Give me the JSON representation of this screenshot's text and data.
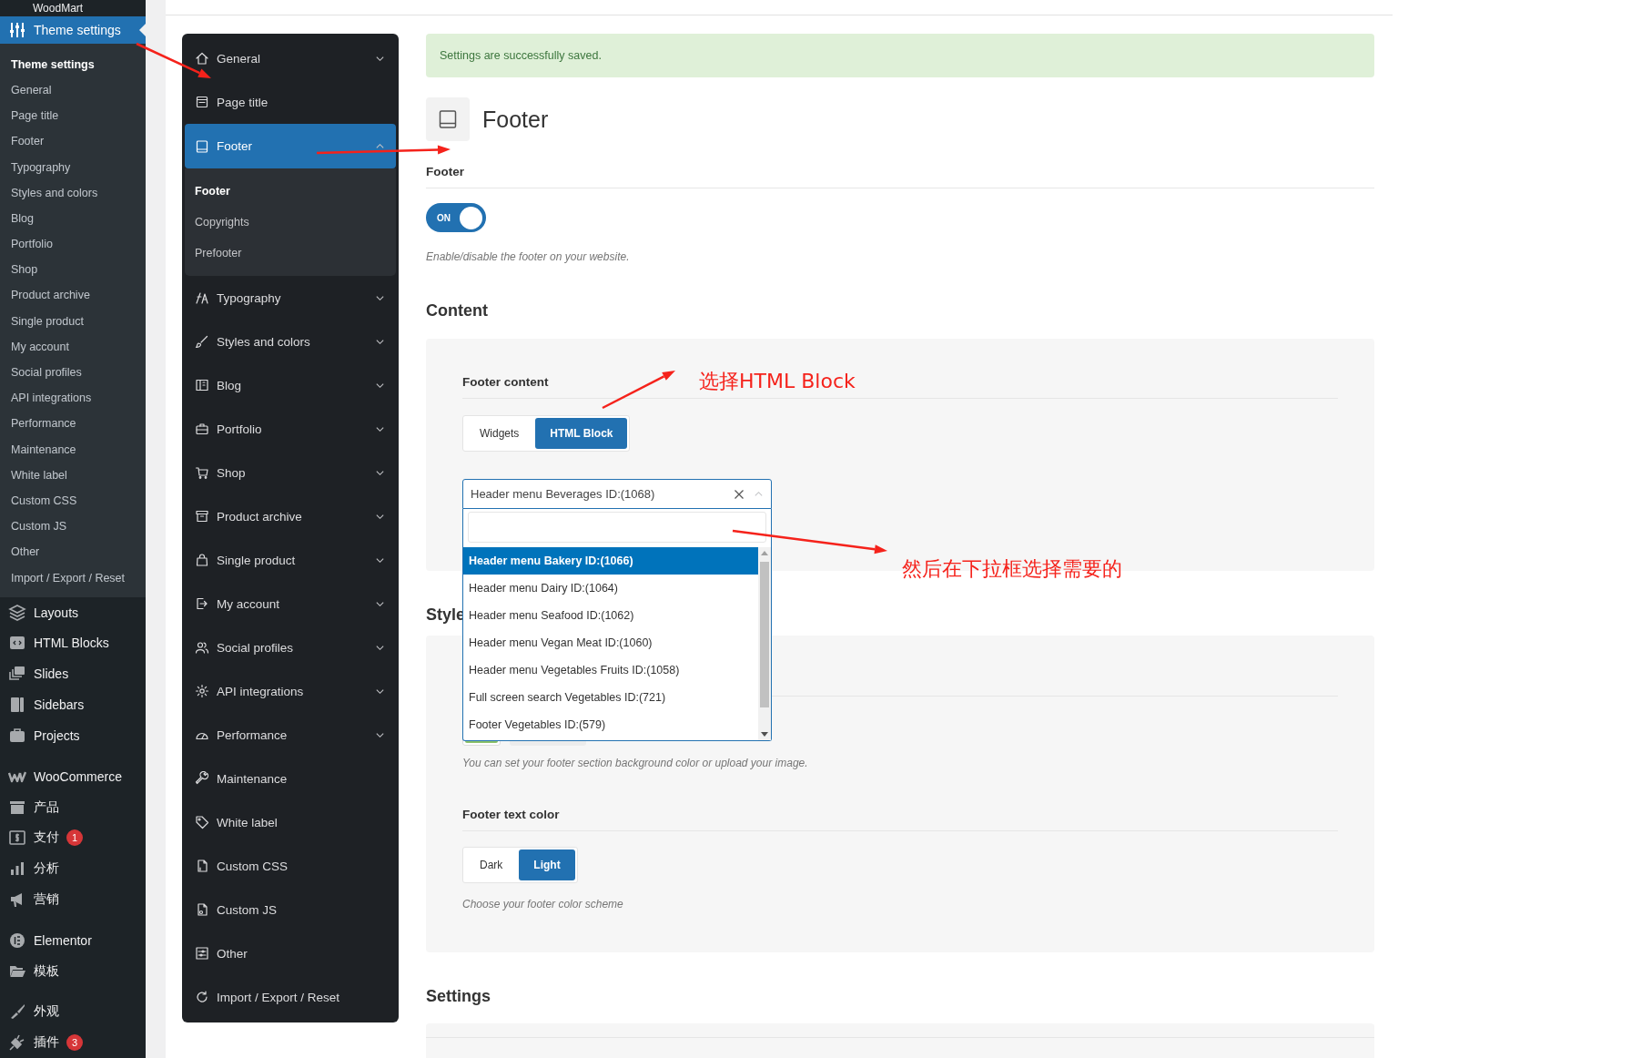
{
  "admin_menu": {
    "cut_item": "WoodMart",
    "groups": [
      [
        {
          "label": "Theme settings",
          "selected": true,
          "children": [
            {
              "label": "Theme settings",
              "selected": true
            },
            {
              "label": "General",
              "selected": false
            },
            {
              "label": "Page title",
              "selected": false
            },
            {
              "label": "Footer",
              "selected": false
            },
            {
              "label": "Typography",
              "selected": false
            },
            {
              "label": "Styles and colors",
              "selected": false
            },
            {
              "label": "Blog",
              "selected": false
            },
            {
              "label": "Portfolio",
              "selected": false
            },
            {
              "label": "Shop",
              "selected": false
            },
            {
              "label": "Product archive",
              "selected": false
            },
            {
              "label": "Single product",
              "selected": false
            },
            {
              "label": "My account",
              "selected": false
            },
            {
              "label": "Social profiles",
              "selected": false
            },
            {
              "label": "API integrations",
              "selected": false
            },
            {
              "label": "Performance",
              "selected": false
            },
            {
              "label": "Maintenance",
              "selected": false
            },
            {
              "label": "White label",
              "selected": false
            },
            {
              "label": "Custom CSS",
              "selected": false
            },
            {
              "label": "Custom JS",
              "selected": false
            },
            {
              "label": "Other",
              "selected": false
            },
            {
              "label": "Import / Export / Reset",
              "selected": false
            }
          ]
        },
        {
          "label": "Layouts",
          "selected": false
        },
        {
          "label": "HTML Blocks",
          "selected": false
        },
        {
          "label": "Slides",
          "selected": false
        },
        {
          "label": "Sidebars",
          "selected": false
        },
        {
          "label": "Projects",
          "selected": false
        }
      ],
      [
        {
          "label": "WooCommerce",
          "selected": false
        },
        {
          "label": "产品",
          "selected": false
        },
        {
          "label": "支付",
          "selected": false,
          "badge": "1"
        },
        {
          "label": "分析",
          "selected": false
        },
        {
          "label": "营销",
          "selected": false
        }
      ],
      [
        {
          "label": "Elementor",
          "selected": false
        },
        {
          "label": "模板",
          "selected": false
        }
      ],
      [
        {
          "label": "外观",
          "selected": false
        },
        {
          "label": "插件",
          "selected": false,
          "badge": "3"
        }
      ]
    ]
  },
  "settings_nav": {
    "items": [
      {
        "label": "General",
        "selected": false,
        "expanded": false
      },
      {
        "label": "Page title",
        "selected": false
      },
      {
        "label": "Footer",
        "selected": true,
        "expanded": true,
        "children": [
          {
            "label": "Footer",
            "selected": true
          },
          {
            "label": "Copyrights",
            "selected": false
          },
          {
            "label": "Prefooter",
            "selected": false
          }
        ]
      },
      {
        "label": "Typography",
        "selected": false,
        "expanded": false
      },
      {
        "label": "Styles and colors",
        "selected": false,
        "expanded": false
      },
      {
        "label": "Blog",
        "selected": false,
        "expanded": false
      },
      {
        "label": "Portfolio",
        "selected": false,
        "expanded": false
      },
      {
        "label": "Shop",
        "selected": false,
        "expanded": false
      },
      {
        "label": "Product archive",
        "selected": false,
        "expanded": false
      },
      {
        "label": "Single product",
        "selected": false,
        "expanded": false
      },
      {
        "label": "My account",
        "selected": false,
        "expanded": false
      },
      {
        "label": "Social profiles",
        "selected": false,
        "expanded": false
      },
      {
        "label": "API integrations",
        "selected": false,
        "expanded": false
      },
      {
        "label": "Performance",
        "selected": false,
        "expanded": false
      },
      {
        "label": "Maintenance",
        "selected": false
      },
      {
        "label": "White label",
        "selected": false
      },
      {
        "label": "Custom CSS",
        "selected": false
      },
      {
        "label": "Custom JS",
        "selected": false
      },
      {
        "label": "Other",
        "selected": false
      },
      {
        "label": "Import / Export / Reset",
        "selected": false
      }
    ]
  },
  "notice": "Settings are successfully saved.",
  "page": {
    "title": "Footer"
  },
  "footer_field": {
    "label": "Footer",
    "toggle": {
      "label": "ON",
      "on": true
    },
    "description": "Enable/disable the footer on your website."
  },
  "content_section": {
    "title": "Content",
    "footer_content": {
      "label": "Footer content",
      "options": [
        {
          "label": "Widgets",
          "selected": false
        },
        {
          "label": "HTML Block",
          "selected": true
        }
      ],
      "select": {
        "value": "Header menu Beverages ID:(1068)",
        "expanded": true,
        "options": [
          {
            "label": "Header menu Bakery ID:(1066)",
            "selected": true
          },
          {
            "label": "Header menu Dairy ID:(1064)",
            "selected": false
          },
          {
            "label": "Header menu Seafood ID:(1062)",
            "selected": false
          },
          {
            "label": "Header menu Vegan Meat ID:(1060)",
            "selected": false
          },
          {
            "label": "Header menu Vegetables Fruits ID:(1058)",
            "selected": false
          },
          {
            "label": "Full screen search Vegetables ID:(721)",
            "selected": false
          },
          {
            "label": "Footer Vegetables ID:(579)",
            "selected": false
          }
        ]
      }
    }
  },
  "style_section": {
    "title": "Style",
    "background_description": "You can set your footer section background color or upload your image.",
    "text_color": {
      "label": "Footer text color",
      "options": [
        {
          "label": "Dark",
          "selected": false
        },
        {
          "label": "Light",
          "selected": true
        }
      ],
      "description": "Choose your footer color scheme"
    }
  },
  "settings_section": {
    "title": "Settings"
  },
  "annotations": [
    {
      "text": "选择HTML Block"
    },
    {
      "text": "然后在下拉框选择需要的"
    }
  ]
}
